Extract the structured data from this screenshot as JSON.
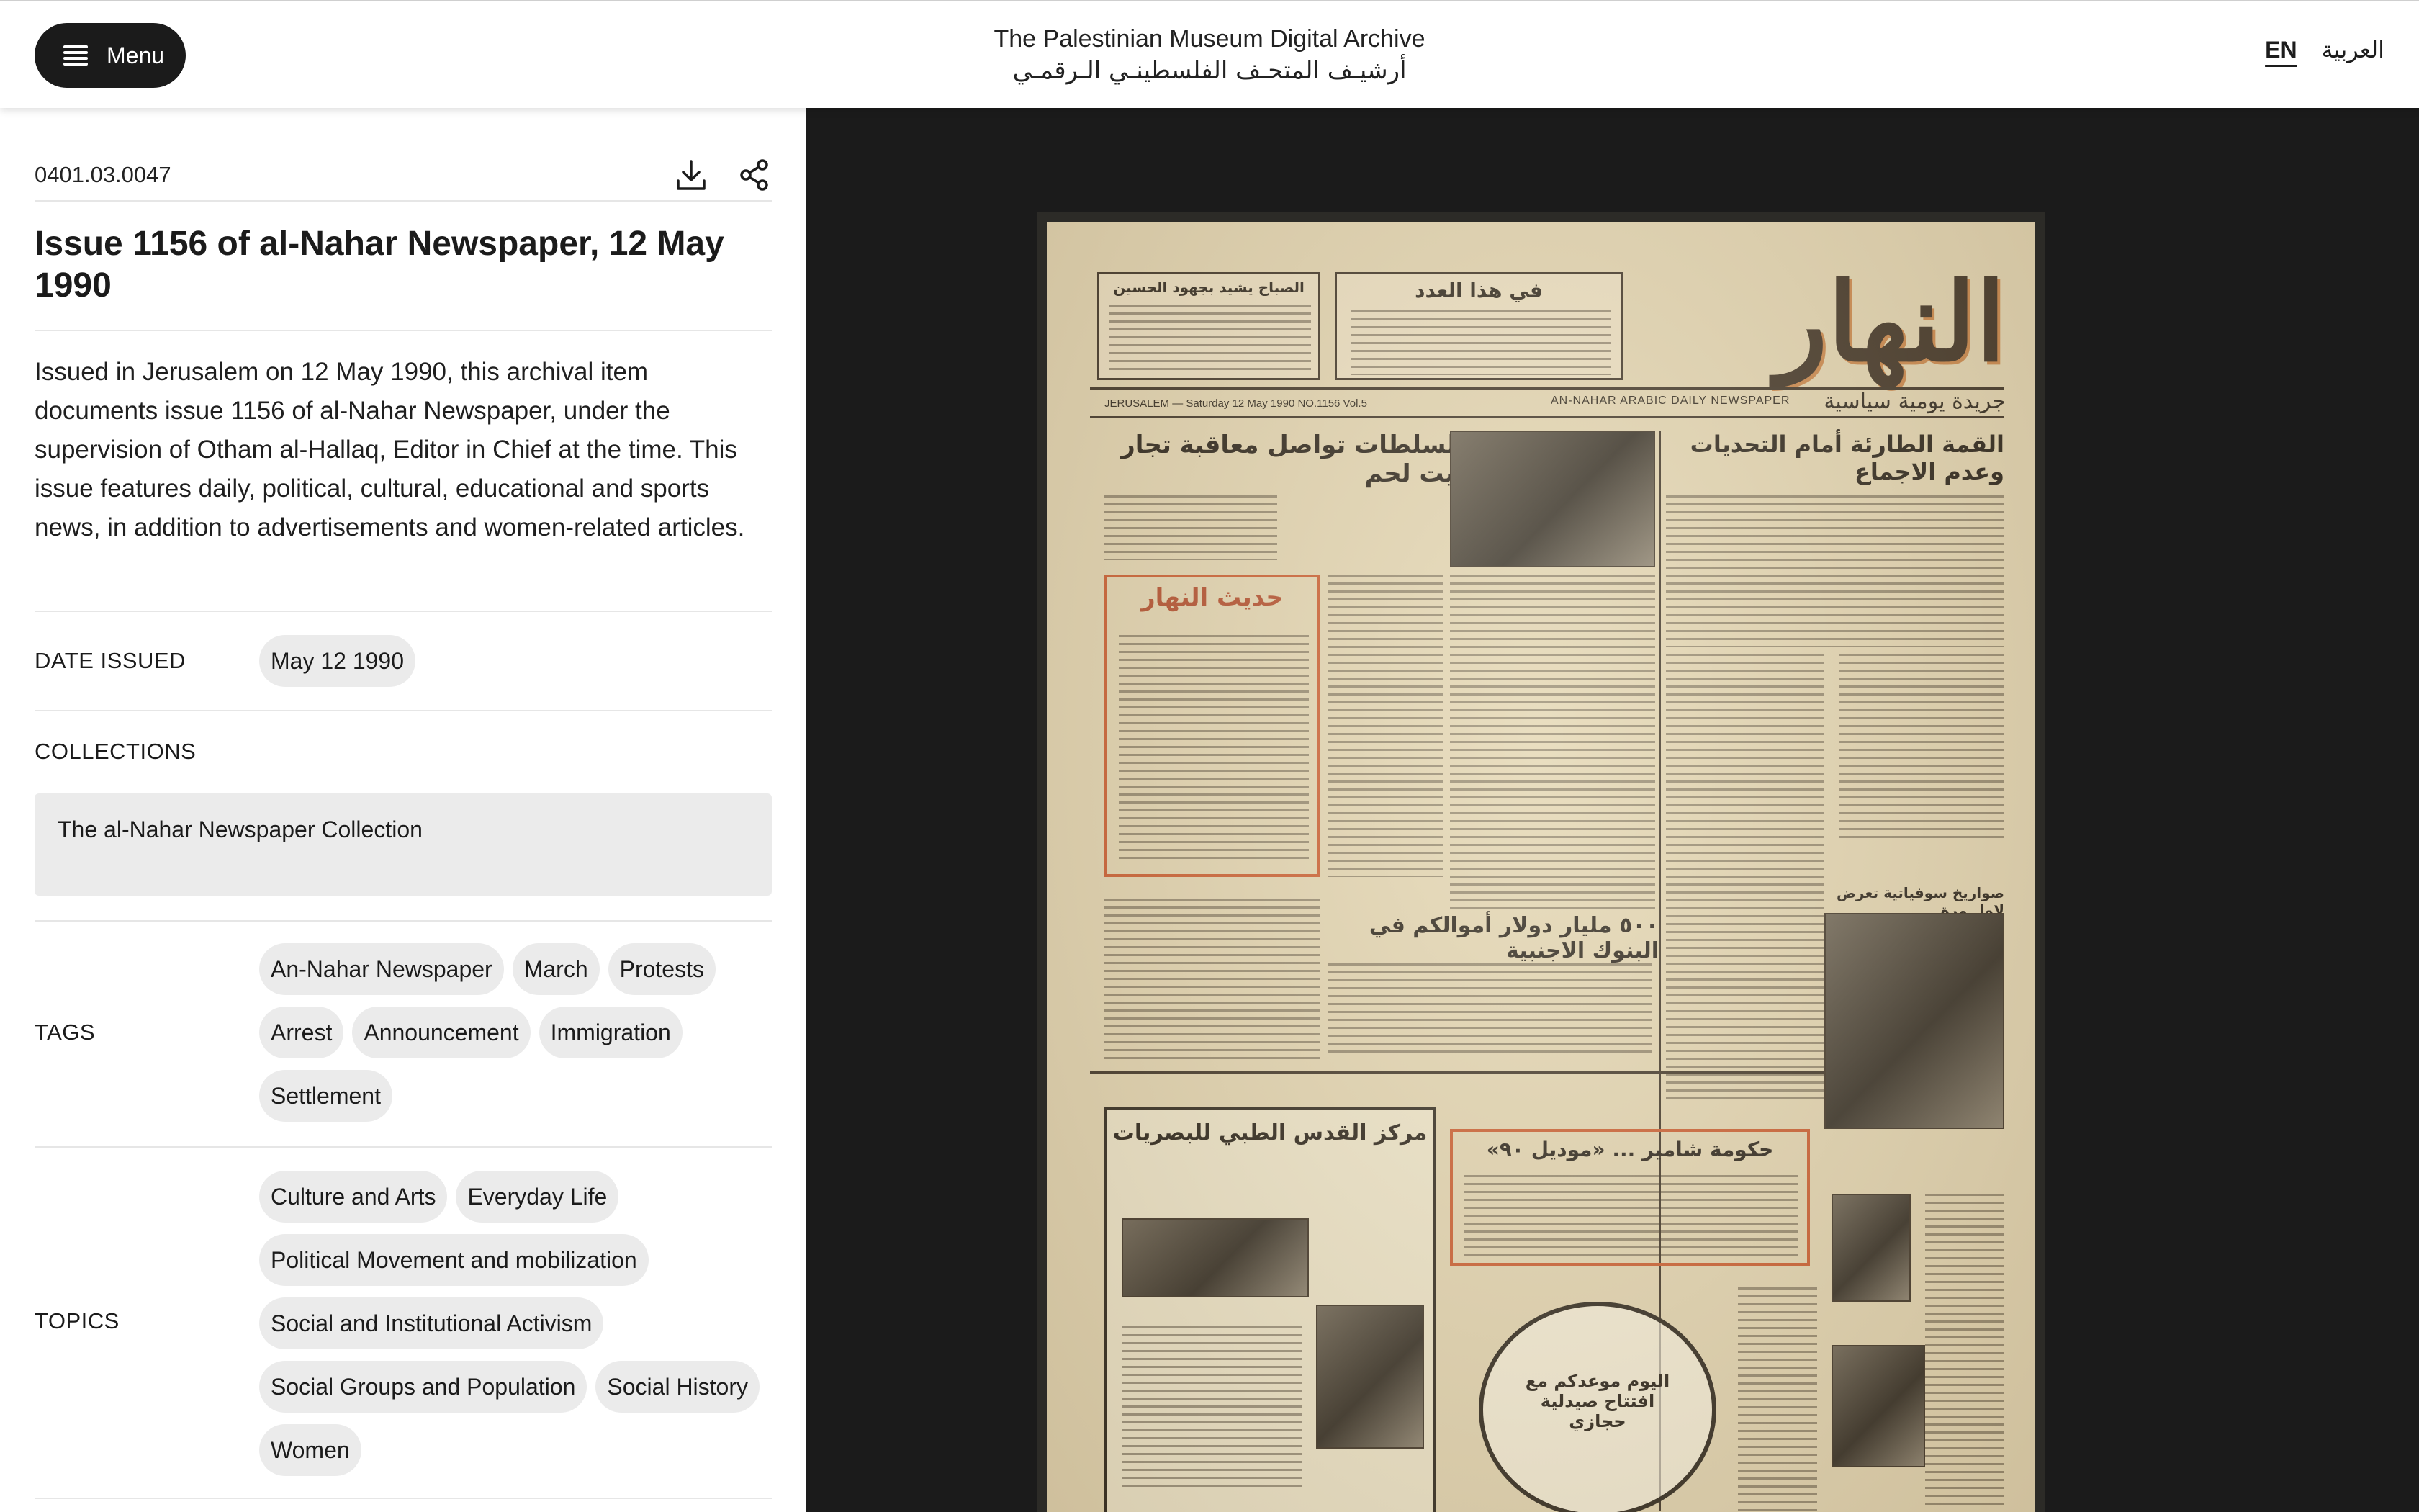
{
  "header": {
    "menu_label": "Menu",
    "brand_en": "The Palestinian Museum Digital Archive",
    "brand_ar": "أرشيـف المتحـف الفلسطينـي الـرقمـي",
    "lang_en": "EN",
    "lang_ar": "العربية"
  },
  "item": {
    "id": "0401.03.0047",
    "title": "Issue 1156 of al-Nahar Newspaper, 12 May 1990",
    "description": "Issued in Jerusalem on 12 May 1990, this archival item documents issue 1156 of al-Nahar Newspaper, under the supervision of Otham al-Hallaq, Editor in Chief at the time. This issue features daily, political, cultural, educational and sports news, in addition to advertisements and women-related articles.",
    "date_label": "DATE ISSUED",
    "date_value": "May 12 1990",
    "collections_label": "COLLECTIONS",
    "collection": "The al-Nahar Newspaper Collection",
    "tags_label": "TAGS",
    "tags": [
      "An-Nahar Newspaper",
      "March",
      "Protests",
      "Arrest",
      "Announcement",
      "Immigration",
      "Settlement"
    ],
    "topics_label": "TOPICS",
    "topics": [
      "Culture and Arts",
      "Everyday Life",
      "Political Movement and mobilization",
      "Social and Institutional Activism",
      "Social Groups and Population",
      "Social History",
      "Women"
    ]
  },
  "newspaper": {
    "title_ar": "النهار",
    "subtitle_ar": "جريدة يومية سياسية",
    "masthead_en": "AN-NAHAR ARABIC DAILY NEWSPAPER",
    "dateline": "JERUSALEM — Saturday 12 May 1990 NO.1156 Vol.5",
    "box1": "في هذا العدد",
    "box2": "الصباح يشيد بجهود الحسين",
    "headline1": "القمة الطارئة أمام التحديات وعدم الاجماع",
    "headline2": "السلطات تواصل معاقبة تجار بيت لحم",
    "column_head": "حديث النهار",
    "headline3": "٥٠٠ مليار دولار أموالكم في البنوك الاجنبية",
    "headline4": "حكومة شامير ... «موديل ٩٠»",
    "headline5": "صواريخ سوفياتية تعرض لاول مرة",
    "ad1": "مركز القدس الطبي للبصريات",
    "ad2": "اليوم موعدكم مع افتتاح صيدلية حجازي"
  },
  "icons": {
    "menu": "hamburger-icon",
    "download": "download-icon",
    "share": "share-icon"
  }
}
